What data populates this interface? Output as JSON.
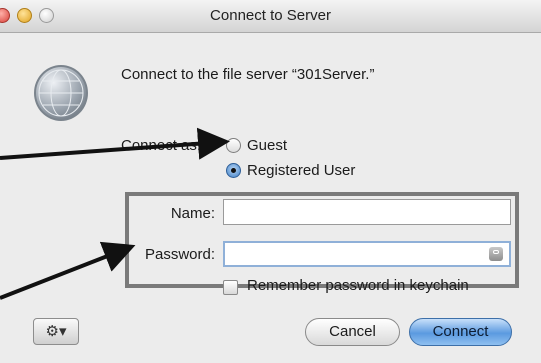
{
  "window": {
    "title": "Connect to Server"
  },
  "server_message": "Connect to the file server “301Server.”",
  "connect_as": {
    "label": "Connect as:",
    "options": [
      {
        "label": "Guest",
        "selected": false
      },
      {
        "label": "Registered User",
        "selected": true
      }
    ]
  },
  "fields": {
    "name_label": "Name:",
    "name_value": "",
    "password_label": "Password:",
    "password_value": ""
  },
  "remember_label": "Remember password in keychain",
  "remember_checked": false,
  "buttons": {
    "actions_icon": "gear-icon",
    "cancel": "Cancel",
    "connect": "Connect"
  },
  "colors": {
    "highlight_box": "#7a7a7a",
    "arrow": "#111111",
    "default_button": "#5b9ae0"
  }
}
